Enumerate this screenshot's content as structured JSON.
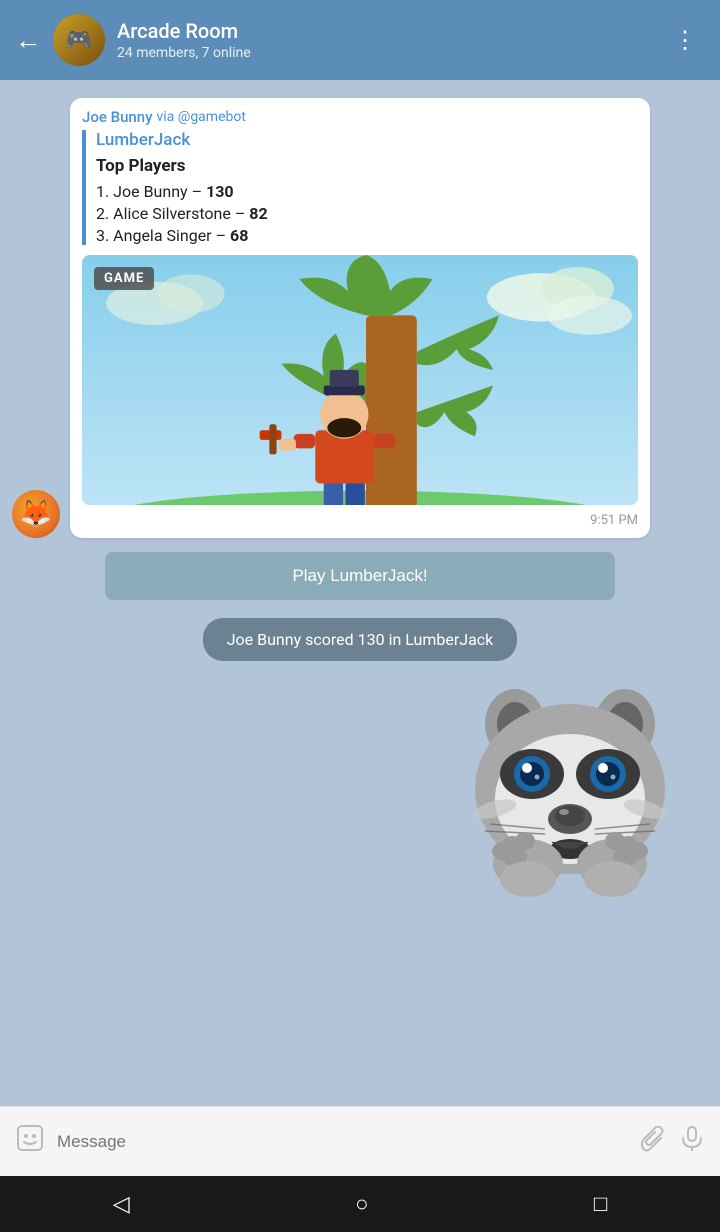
{
  "header": {
    "title": "Arcade Room",
    "subtitle": "24 members, 7 online",
    "avatar_emoji": "🎮"
  },
  "message": {
    "sender": "Joe Bunny",
    "via": "via @gamebot",
    "game_name": "LumberJack",
    "top_players_label": "Top Players",
    "players": [
      {
        "rank": "1.",
        "name": "Joe Bunny",
        "score": "130"
      },
      {
        "rank": "2.",
        "name": "Alice Silverstone",
        "score": "82"
      },
      {
        "rank": "3.",
        "name": "Angela Singer",
        "score": "68"
      }
    ],
    "game_badge": "GAME",
    "time": "9:51 PM"
  },
  "play_button": {
    "label": "Play LumberJack!"
  },
  "score_notification": {
    "text": "Joe Bunny scored 130 in LumberJack"
  },
  "input_bar": {
    "placeholder": "Message"
  },
  "nav": {
    "back": "◁",
    "home": "○",
    "recent": "□"
  }
}
